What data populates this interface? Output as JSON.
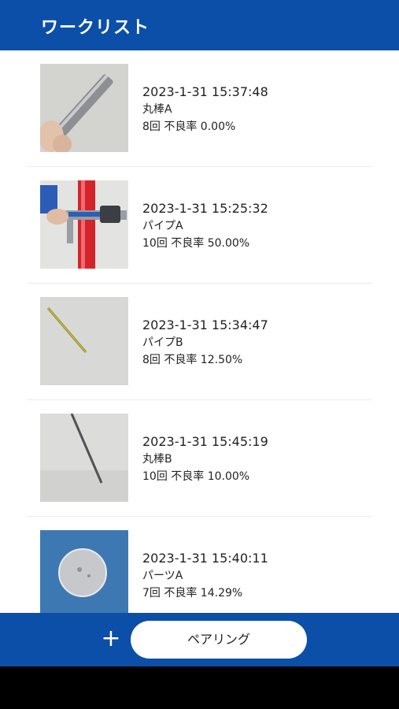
{
  "header": {
    "title": "ワークリスト"
  },
  "items": [
    {
      "timestamp": "2023-1-31 15:37:48",
      "name": "丸棒A",
      "stats": "8回 不良率 0.00%",
      "image": "metal-rod-in-hand"
    },
    {
      "timestamp": "2023-1-31 15:25:32",
      "name": "パイプA",
      "stats": "10回 不良率 50.00%",
      "image": "red-pipe-with-caliper"
    },
    {
      "timestamp": "2023-1-31 15:34:47",
      "name": "パイプB",
      "stats": "8回 不良率 12.50%",
      "image": "thin-yellow-pipe"
    },
    {
      "timestamp": "2023-1-31 15:45:19",
      "name": "丸棒B",
      "stats": "10回 不良率 10.00%",
      "image": "thin-rod"
    },
    {
      "timestamp": "2023-1-31 15:40:11",
      "name": "パーツA",
      "stats": "7回 不良率 14.29%",
      "image": "round-metal-part"
    }
  ],
  "footer": {
    "add_label": "+",
    "pairing_label": "ペアリング"
  }
}
